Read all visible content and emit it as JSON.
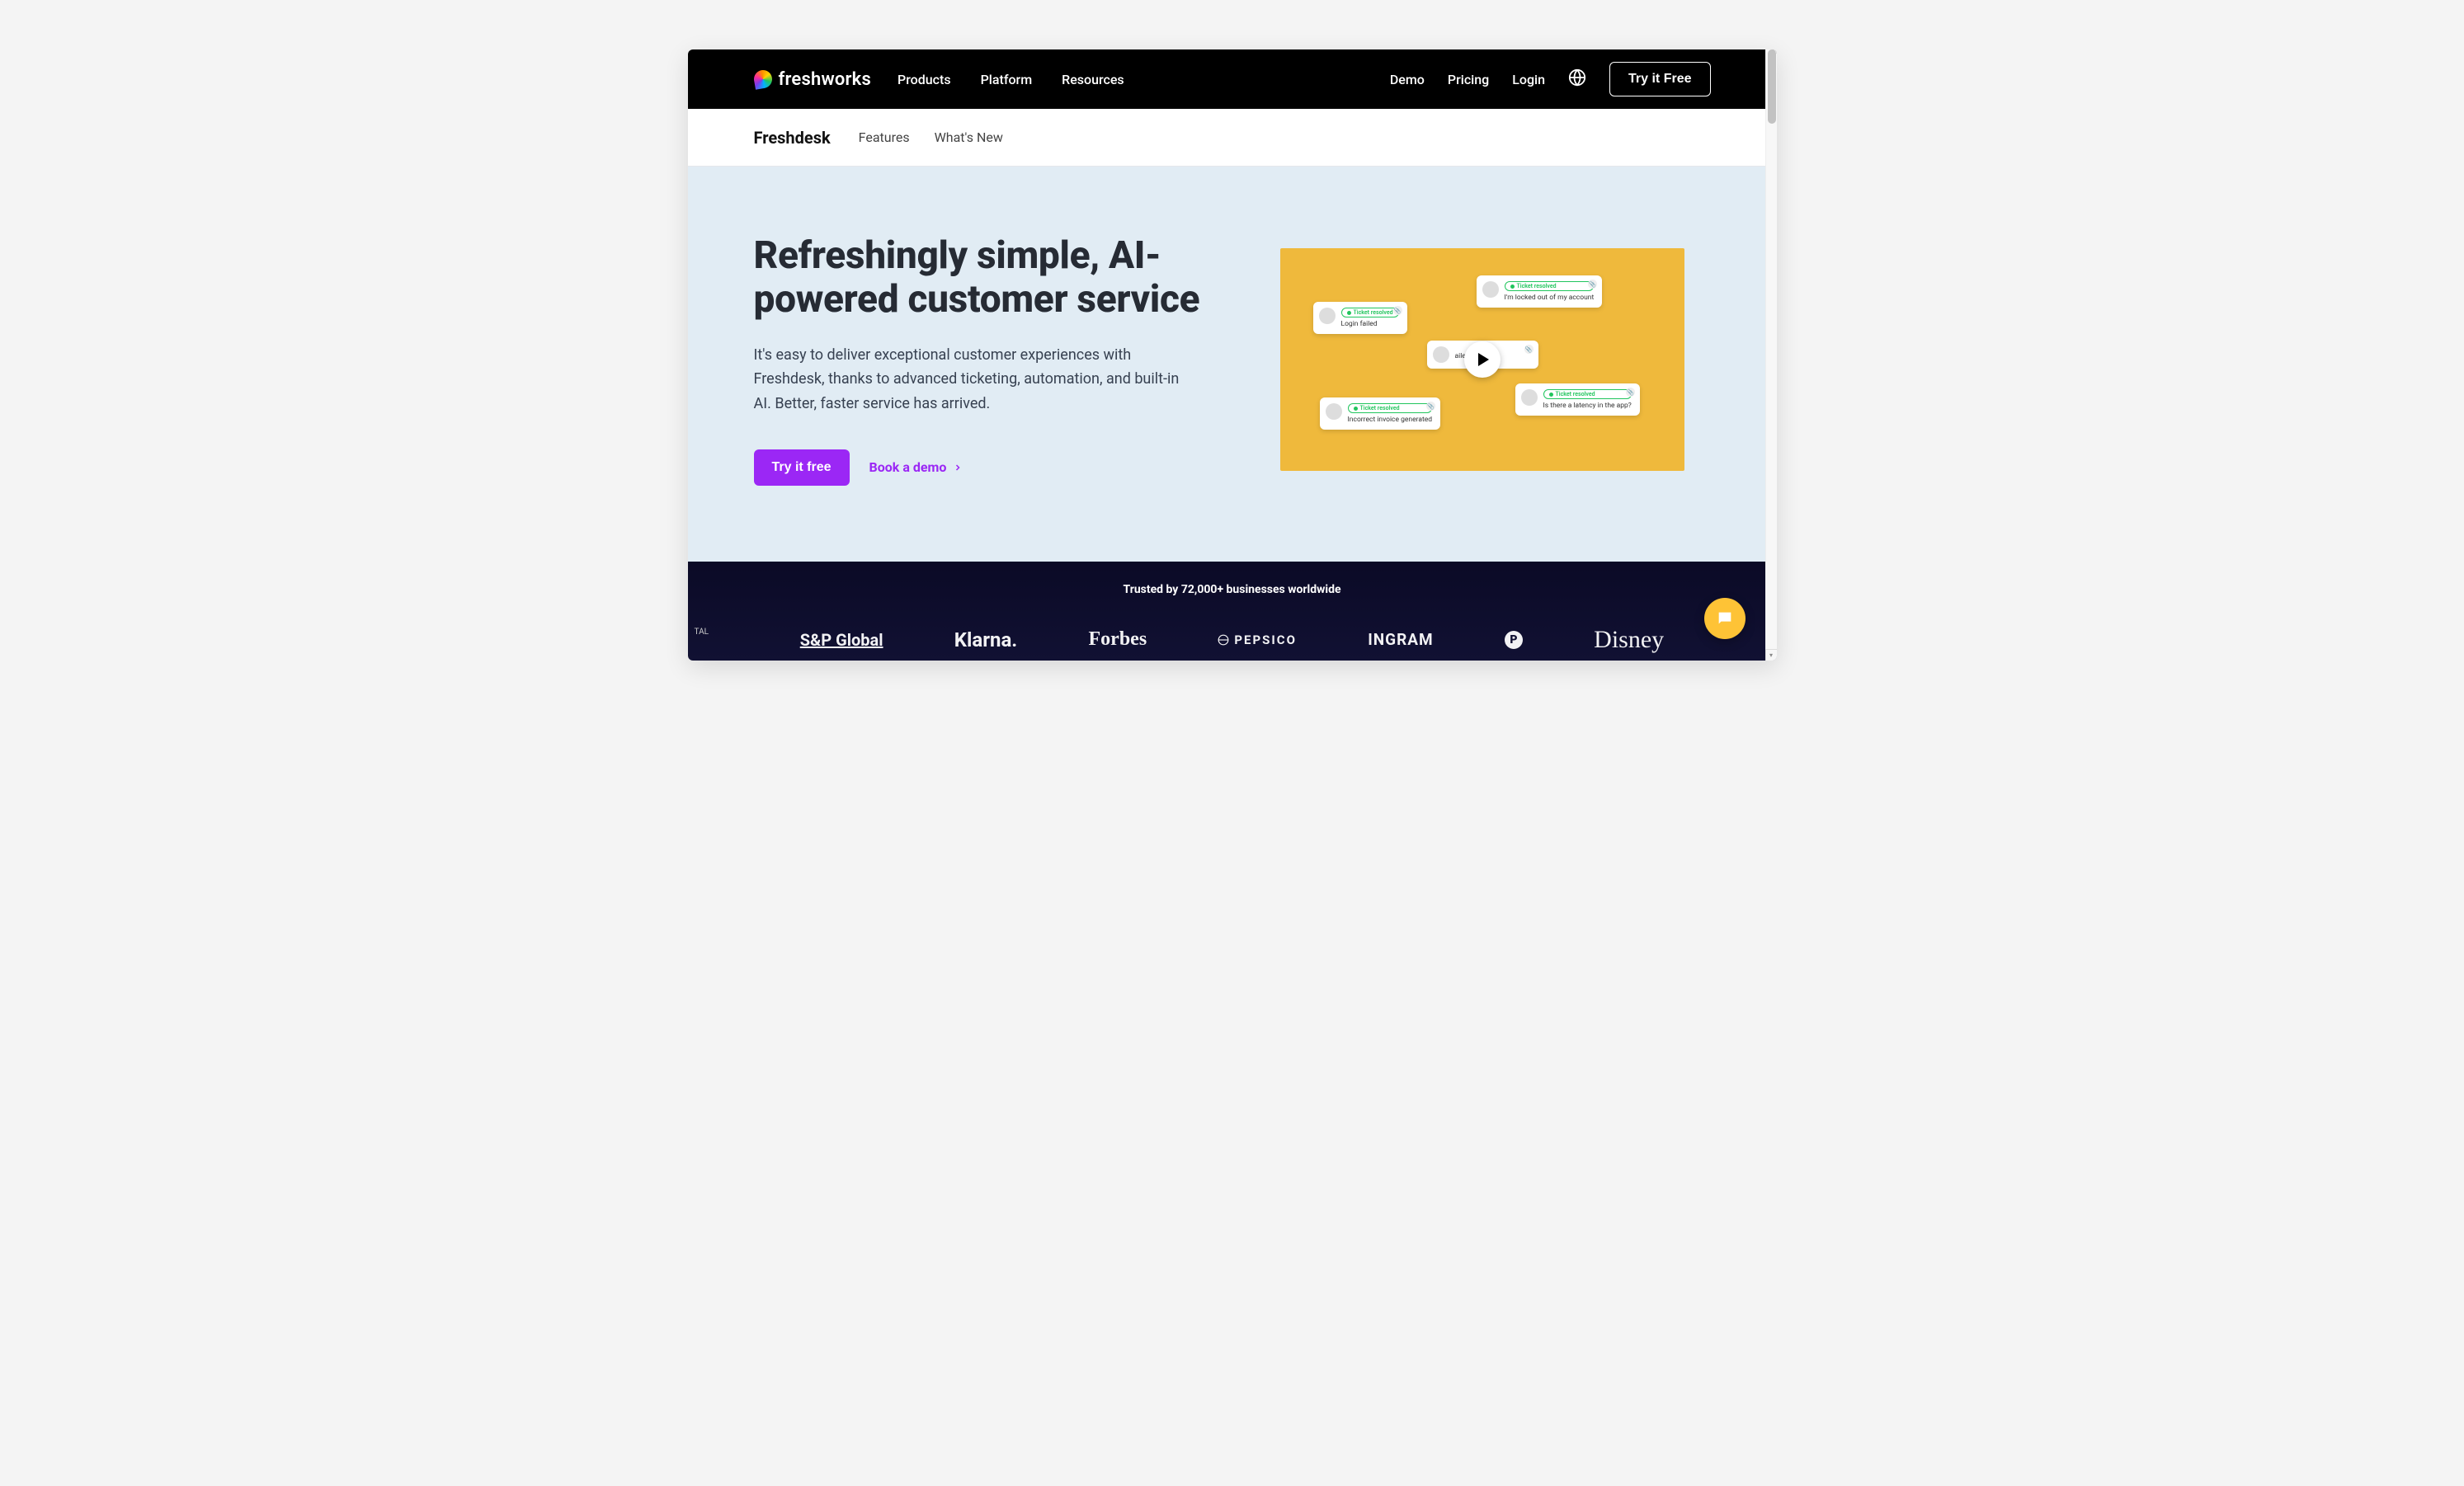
{
  "logo": {
    "text": "freshworks"
  },
  "nav": {
    "primary": [
      "Products",
      "Platform",
      "Resources"
    ],
    "secondary": [
      "Demo",
      "Pricing",
      "Login"
    ],
    "cta": "Try it Free"
  },
  "subnav": {
    "brand": "Freshdesk",
    "items": [
      "Features",
      "What's New"
    ]
  },
  "hero": {
    "title": "Refreshingly simple, AI-powered customer service",
    "body": "It's easy to deliver exceptional customer experiences with Freshdesk, thanks to advanced ticketing, automation, and built-in AI. Better, faster service has arrived.",
    "primary_cta": "Try it free",
    "secondary_cta": "Book a demo",
    "tickets": {
      "status_label": "Ticket resolved",
      "items": [
        {
          "msg": "Login failed"
        },
        {
          "msg": "I'm locked out of my account"
        },
        {
          "msg": "ailed"
        },
        {
          "msg": "Incorrect invoice generated"
        },
        {
          "msg": "Is there a latency in the app?"
        }
      ]
    }
  },
  "trust": {
    "tagline": "Trusted by 72,000+ businesses worldwide",
    "logos": {
      "sp": "S&P Global",
      "klarna": "Klarna.",
      "forbes": "Forbes",
      "pepsico": "PEPSICO",
      "ingram": "INGRAM",
      "pearson": "P",
      "disney": "Disney"
    },
    "partial_left": "TAL"
  }
}
